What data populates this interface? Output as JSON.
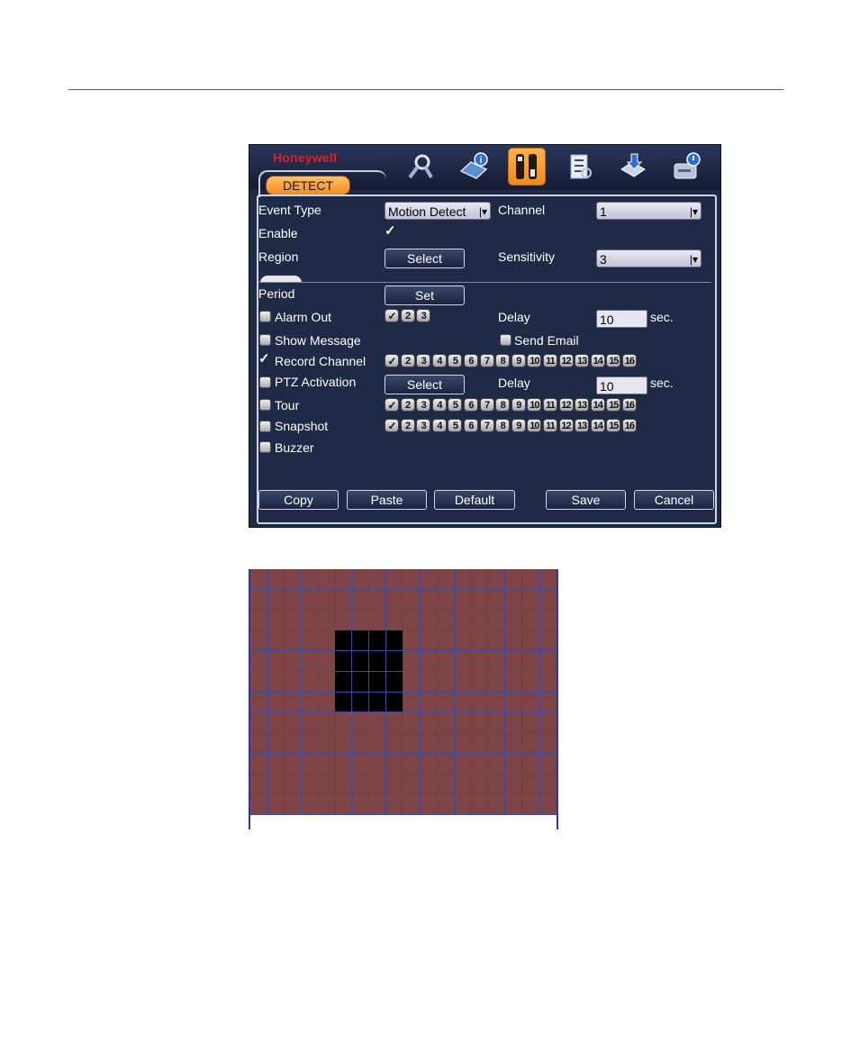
{
  "brand": "Honeywell",
  "tab": "DETECT",
  "toolbar_icons": [
    "search-icon",
    "info-icon",
    "tools-icon",
    "checklist-icon",
    "backup-icon",
    "disk-icon"
  ],
  "event_type": {
    "label": "Event Type",
    "value": "Motion Detect"
  },
  "channel": {
    "label": "Channel",
    "value": "1"
  },
  "enable": {
    "label": "Enable",
    "checked": true
  },
  "region": {
    "label": "Region",
    "button": "Select"
  },
  "sensitivity": {
    "label": "Sensitivity",
    "value": "3"
  },
  "period": {
    "label": "Period",
    "button": "Set"
  },
  "alarm_out": {
    "label": "Alarm Out",
    "checked": false,
    "outputs": [
      "✓",
      "2",
      "3"
    ]
  },
  "delay1": {
    "label": "Delay",
    "value": "10",
    "unit": "sec."
  },
  "show_message": {
    "label": "Show Message",
    "checked": false
  },
  "send_email": {
    "label": "Send Email",
    "checked": false
  },
  "record_channel": {
    "label": "Record Channel",
    "checked": true
  },
  "ptz": {
    "label": "PTZ Activation",
    "checked": false,
    "button": "Select"
  },
  "delay2": {
    "label": "Delay",
    "value": "10",
    "unit": "sec."
  },
  "tour": {
    "label": "Tour",
    "checked": false
  },
  "snapshot": {
    "label": "Snapshot",
    "checked": false
  },
  "buzzer": {
    "label": "Buzzer",
    "checked": false
  },
  "channels": [
    "✓",
    "2",
    "3",
    "4",
    "5",
    "6",
    "7",
    "8",
    "9",
    "10",
    "11",
    "12",
    "13",
    "14",
    "15",
    "16"
  ],
  "buttons": {
    "copy": "Copy",
    "paste": "Paste",
    "default": "Default",
    "save": "Save",
    "cancel": "Cancel"
  },
  "region_grid": {
    "cols": 18,
    "rows": 12,
    "selected": {
      "col_start": 5,
      "col_end": 9,
      "row_start": 3,
      "row_end": 7
    }
  },
  "colors": {
    "grid_cell": "#7f4446",
    "grid_selected": "#000000",
    "grid_line": "#3c4aa0",
    "accent": "#f28a1e",
    "brand": "#e02020"
  }
}
